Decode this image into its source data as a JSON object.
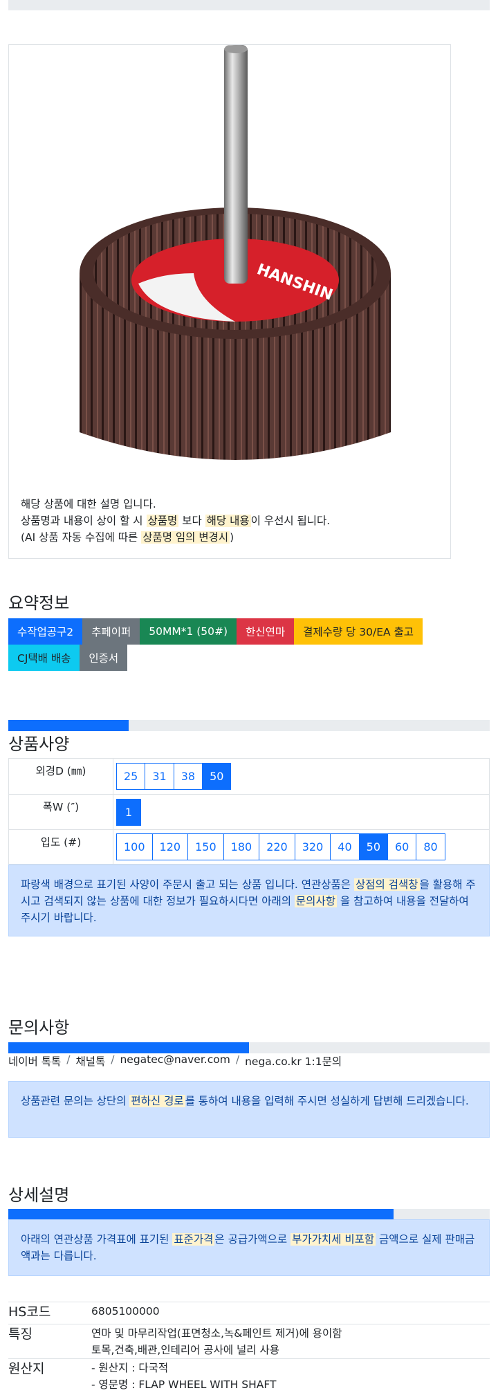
{
  "product": {
    "description_lines": [
      {
        "parts": [
          "해당 상품에 대한 설명 입니다."
        ]
      },
      {
        "parts": [
          "상품명과 내용이 상이 할 시 ",
          "상품명",
          " 보다 ",
          "해당 내용",
          "이 우선시 됩니다."
        ]
      },
      {
        "parts": [
          "(AI 상품 자동 수집에 따른 ",
          "상품명 임의 변경시",
          ")"
        ]
      }
    ],
    "image_label_text": "HANSHIN"
  },
  "summary": {
    "title": "요약정보",
    "badges": [
      {
        "label": "수작업공구2",
        "color": "#0d6efd"
      },
      {
        "label": "추페이퍼",
        "color": "#6c757d"
      },
      {
        "label": "50MM*1 (50#)",
        "color": "#198754"
      },
      {
        "label": "한신연마",
        "color": "#dc3545"
      },
      {
        "label": "결제수량 당 30/EA 출고",
        "color": "#ffc107"
      },
      {
        "label": "CJ택배 배송",
        "color": "#0dcaf0"
      },
      {
        "label": "인증서",
        "color": "#6c757d"
      }
    ]
  },
  "spec": {
    "title": "상품사양",
    "progress_percent": 25,
    "rows": [
      {
        "label": "외경D (㎜)",
        "options": [
          "25",
          "31",
          "38",
          "50"
        ],
        "selected": "50"
      },
      {
        "label": "폭W (″)",
        "options": [
          "1"
        ],
        "selected": "1"
      },
      {
        "label": "입도 (#)",
        "options": [
          "100",
          "120",
          "150",
          "180",
          "220",
          "320",
          "40",
          "50",
          "60",
          "80"
        ],
        "selected": "50"
      }
    ],
    "notice": {
      "t1": "파랑색 배경으로 표기된 사양이 주문시 출고 되는 상품 입니다. 연관상품은 ",
      "h1": "상점의 검색창",
      "t2": "을 활용해 주시고 검색되지 않는 상품에 대한 정보가 필요하시다면 아래의 ",
      "h2": "문의사항",
      "t3": " 을 참고하여 내용을 전달하여 주시기 바랍니다."
    }
  },
  "inquiry": {
    "title": "문의사항",
    "progress_percent": 50,
    "links": [
      "네이버 톡톡",
      "채널톡",
      "negatec@naver.com",
      "nega.co.kr 1:1문의"
    ],
    "separator": "/",
    "notice": {
      "t1": "상품관련 문의는 상단의 ",
      "h1": "편하신 경로",
      "t2": "를 통하여 내용을 입력해 주시면 성실하게 답변해 드리겠습니다."
    }
  },
  "detail": {
    "title": "상세설명",
    "progress_percent": 80,
    "notice": {
      "t1": "아래의 연관상품 가격표에 표기된 ",
      "h1": "표준가격",
      "t2": "은 공급가액으로 ",
      "h2": "부가가치세 비포함",
      "t3": " 금액으로 실제 판매금액과는 다릅니다."
    },
    "info": [
      {
        "label": "HS코드",
        "lines": [
          "6805100000"
        ]
      },
      {
        "label": "특징",
        "lines": [
          "연마 및 마무리작업(표면청소,녹&페인트 제거)에 용이함",
          "토목,건축,배관,인테리어 공사에 널리 사용"
        ]
      },
      {
        "label": "원산지",
        "lines": [
          "- 원산지 : 다국적",
          "- 영문명 : FLAP WHEEL WITH SHAFT"
        ]
      }
    ]
  }
}
